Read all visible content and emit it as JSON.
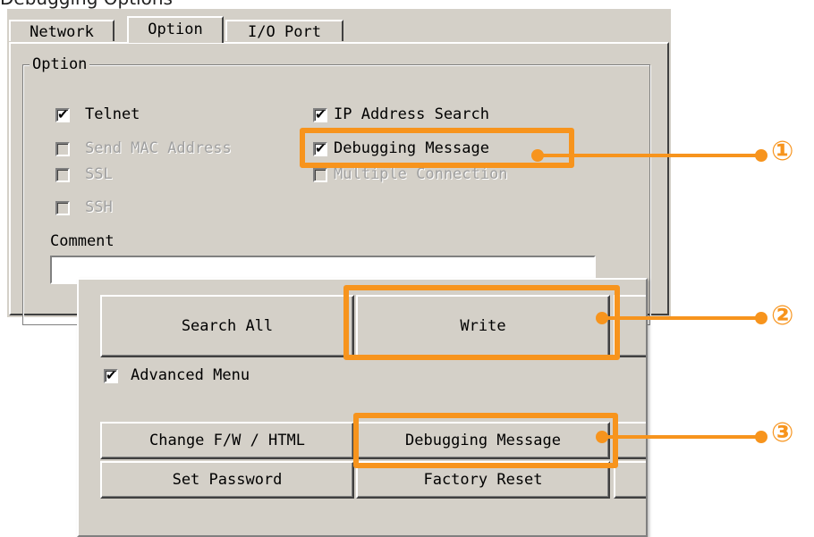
{
  "header_partial": "Debugging Options",
  "tabs": [
    "Network",
    "Option",
    "I/O Port"
  ],
  "option_group": {
    "title": "Option",
    "left_items": [
      {
        "label": "Telnet",
        "checked": true,
        "enabled": true
      },
      {
        "label": "Send MAC Address",
        "checked": false,
        "enabled": false
      },
      {
        "label": "SSL",
        "checked": false,
        "enabled": false
      },
      {
        "label": "SSH",
        "checked": false,
        "enabled": false
      }
    ],
    "right_items": [
      {
        "label": "IP Address Search",
        "checked": true,
        "enabled": true
      },
      {
        "label": "Debugging Message",
        "checked": true,
        "enabled": true
      },
      {
        "label": "Multiple Connection",
        "checked": false,
        "enabled": false
      }
    ],
    "comment_label": "Comment",
    "comment_value": ""
  },
  "main_buttons": {
    "search_all": "Search All",
    "write": "Write"
  },
  "advanced_menu": {
    "label": "Advanced Menu",
    "checked": true
  },
  "advanced_buttons": {
    "change_fw": "Change F/W / HTML",
    "debugging_message": "Debugging Message",
    "set_password": "Set Password",
    "factory_reset": "Factory Reset"
  },
  "callouts": [
    "①",
    "②",
    "③"
  ],
  "colors": {
    "accent": "#f7941d",
    "window": "#d4d0c8"
  }
}
